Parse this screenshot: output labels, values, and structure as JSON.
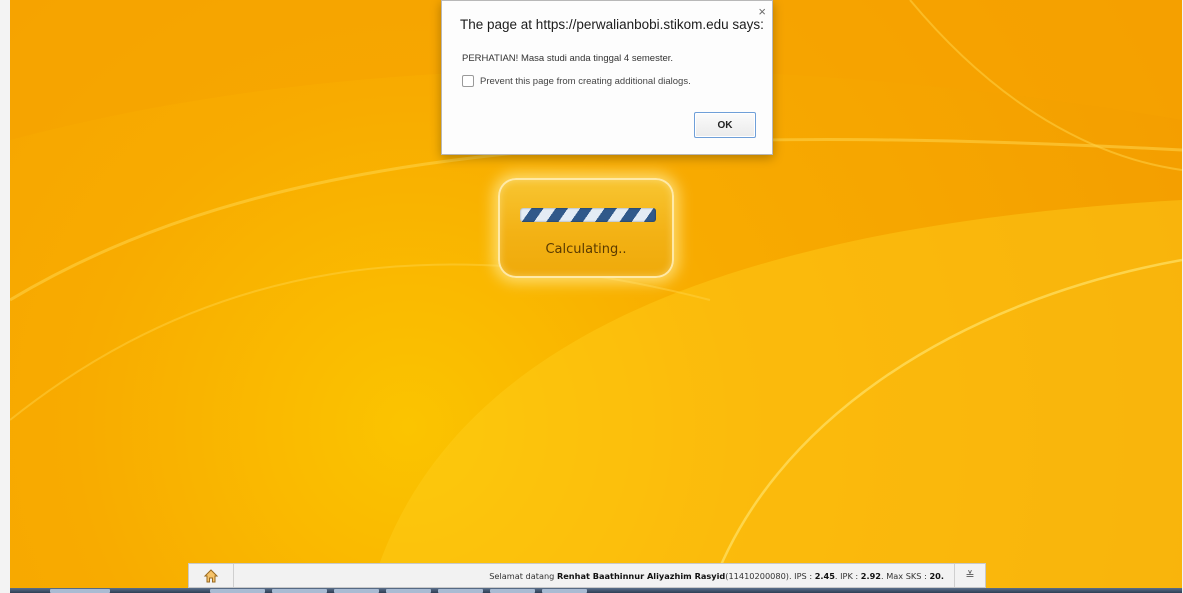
{
  "dialog": {
    "title": "The page at https://perwalianbobi.stikom.edu says:",
    "close_glyph": "×",
    "message": "PERHATIAN! Masa studi anda tinggal 4 semester.",
    "prevent_label": "Prevent this page from creating additional dialogs.",
    "prevent_checked": false,
    "ok_label": "OK"
  },
  "loader": {
    "text": "Calculating.."
  },
  "statusbar": {
    "home_icon": "home-icon",
    "prefix": "Selamat datang ",
    "name": "Renhat Baathinnur Aliyazhim Rasyid",
    "nim": "(11410200080). IPS : ",
    "ips": "2.45",
    "ipk_label": ". IPK : ",
    "ipk": "2.92",
    "sks_label": ". Max SKS : ",
    "max_sks": "20",
    "suffix": ".",
    "collapse_glyph": "≚"
  },
  "colors": {
    "background": "#f8ab00",
    "loader_stripe": "#31598a",
    "ok_border": "#6f9fd8"
  }
}
